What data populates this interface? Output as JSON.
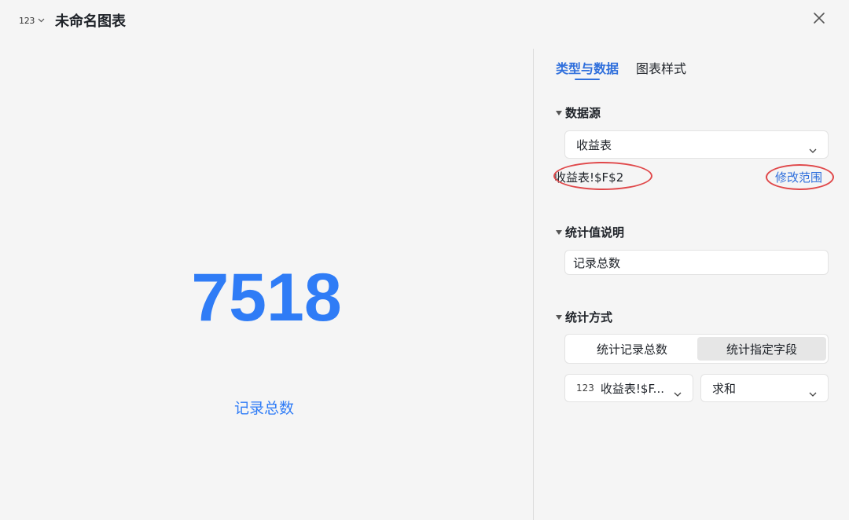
{
  "header": {
    "type_badge": "123",
    "title": "未命名图表"
  },
  "preview": {
    "value": "7518",
    "caption": "记录总数",
    "accent_color": "#2f7cf6"
  },
  "panel": {
    "tabs": [
      {
        "label": "类型与数据",
        "active": true
      },
      {
        "label": "图表样式",
        "active": false
      }
    ],
    "data_source": {
      "heading": "数据源",
      "selected_table": "收益表",
      "range_text": "收益表!$F$2",
      "modify_link": "修改范围"
    },
    "stat_description": {
      "heading": "统计值说明",
      "value": "记录总数"
    },
    "stat_method": {
      "heading": "统计方式",
      "options": [
        {
          "label": "统计记录总数",
          "selected": false
        },
        {
          "label": "统计指定字段",
          "selected": true
        }
      ],
      "field_type_badge": "123",
      "field_value": "收益表!$F...",
      "aggregate_value": "求和"
    }
  },
  "icons": {
    "chevron": "chevron-down-icon",
    "close": "close-icon",
    "collapse": "caret-down-icon"
  },
  "annotations": {
    "highlight_color": "#e0484a"
  }
}
